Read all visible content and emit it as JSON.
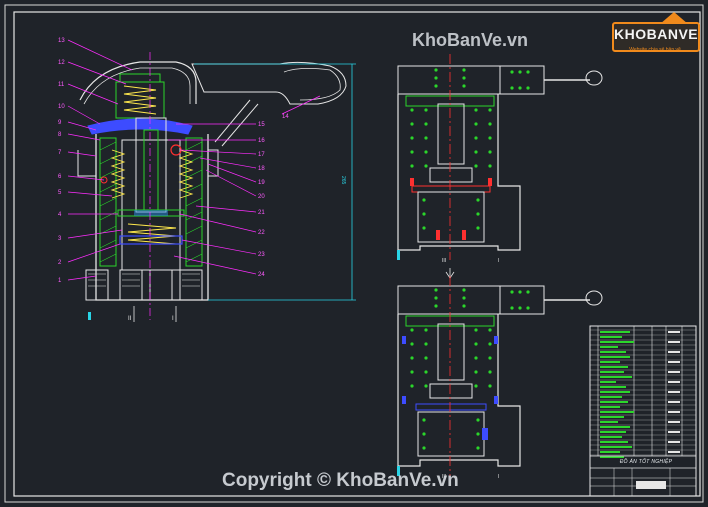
{
  "watermark_top": "KhoBanVe.vn",
  "watermark_bottom": "Copyright © KhoBanVe.vn",
  "logo": {
    "text": "KHOBANVE",
    "subtitle": "Website chia sẻ bản vẽ",
    "accent": "#f08a1c"
  },
  "part_labels_left": [
    "13",
    "12",
    "11",
    "10",
    "9",
    "8",
    "7",
    "6",
    "5",
    "4",
    "3",
    "2",
    "1"
  ],
  "part_labels_right": [
    "14",
    "15",
    "16",
    "17",
    "18",
    "19",
    "20",
    "21",
    "22",
    "23",
    "24"
  ],
  "dimension_label": "265",
  "port_labels_main": [
    "II",
    "I"
  ],
  "port_labels_view_top": [
    "III",
    "I"
  ],
  "port_labels_view_bottom": [
    "III",
    "I"
  ],
  "title_block": {
    "title": "ĐỒ ÁN TỐT NGHIỆP"
  },
  "colors": {
    "background": "#1f2329",
    "frame": "#e6e6e6",
    "section_line": "#ff2dff",
    "label": "#ff5cff",
    "body": "#2bd62b",
    "spring": "#ffe94d",
    "seal": "#3d4cff",
    "highlight": "#ff3030",
    "hatch_green": "#2bd62b",
    "port": "#29d4e6"
  }
}
